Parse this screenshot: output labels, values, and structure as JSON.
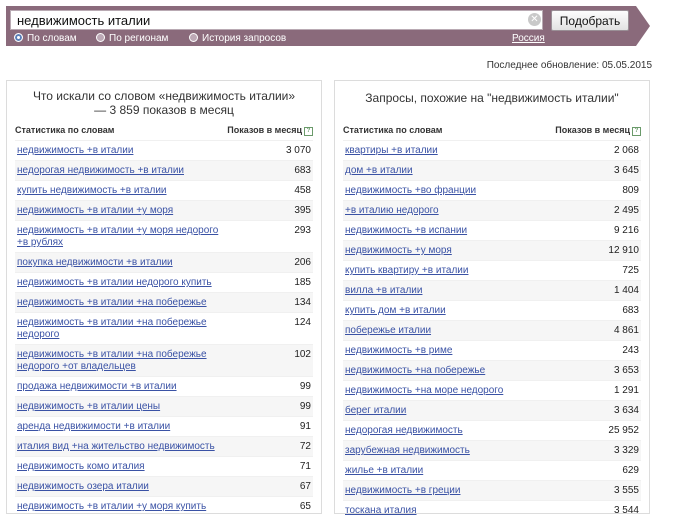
{
  "search": {
    "value": "недвижимость италии",
    "button": "Подобрать"
  },
  "tabs": [
    "По словам",
    "По регионам",
    "История запросов"
  ],
  "region": "Россия",
  "updated": "Последнее обновление: 05.05.2015",
  "left": {
    "title": "Что искали со словом «недвижимость италии» — 3 859 показов в месяц",
    "col1": "Статистика по словам",
    "col2": "Показов в месяц",
    "rows": [
      {
        "q": "недвижимость +в италии",
        "n": "3 070"
      },
      {
        "q": "недорогая недвижимость +в италии",
        "n": "683"
      },
      {
        "q": "купить недвижимость +в италии",
        "n": "458"
      },
      {
        "q": "недвижимость +в италии +у моря",
        "n": "395"
      },
      {
        "q": "недвижимость +в италии +у моря недорого +в рублях",
        "n": "293"
      },
      {
        "q": "покупка недвижимости +в италии",
        "n": "206"
      },
      {
        "q": "недвижимость +в италии недорого купить",
        "n": "185"
      },
      {
        "q": "недвижимость +в италии +на побережье",
        "n": "134"
      },
      {
        "q": "недвижимость +в италии +на побережье недорого",
        "n": "124"
      },
      {
        "q": "недвижимость +в италии +на побережье недорого +от владельцев",
        "n": "102"
      },
      {
        "q": "продажа недвижимости +в италии",
        "n": "99"
      },
      {
        "q": "недвижимость +в италии цены",
        "n": "99"
      },
      {
        "q": "аренда недвижимости +в италии",
        "n": "91"
      },
      {
        "q": "италия вид +на жительство недвижимость",
        "n": "72"
      },
      {
        "q": "недвижимость комо италия",
        "n": "71"
      },
      {
        "q": "недвижимость озера италии",
        "n": "67"
      },
      {
        "q": "недвижимость +в италии +у моря купить",
        "n": "65"
      }
    ]
  },
  "right": {
    "title": "Запросы, похожие на \"недвижимость италии\"",
    "col1": "Статистика по словам",
    "col2": "Показов в месяц",
    "rows": [
      {
        "q": "квартиры +в италии",
        "n": "2 068"
      },
      {
        "q": "дом +в италии",
        "n": "3 645"
      },
      {
        "q": "недвижимость +во франции",
        "n": "809"
      },
      {
        "q": "+в италию недорого",
        "n": "2 495"
      },
      {
        "q": "недвижимость +в испании",
        "n": "9 216"
      },
      {
        "q": "недвижимость +у моря",
        "n": "12 910"
      },
      {
        "q": "купить квартиру +в италии",
        "n": "725"
      },
      {
        "q": "вилла +в италии",
        "n": "1 404"
      },
      {
        "q": "купить дом +в италии",
        "n": "683"
      },
      {
        "q": "побережье италии",
        "n": "4 861"
      },
      {
        "q": "недвижимость +в риме",
        "n": "243"
      },
      {
        "q": "недвижимость +на побережье",
        "n": "3 653"
      },
      {
        "q": "недвижимость +на море недорого",
        "n": "1 291"
      },
      {
        "q": "берег италии",
        "n": "3 634"
      },
      {
        "q": "недорогая недвижимость",
        "n": "25 952"
      },
      {
        "q": "зарубежная недвижимость",
        "n": "3 329"
      },
      {
        "q": "жилье +в италии",
        "n": "629"
      },
      {
        "q": "недвижимость +в греции",
        "n": "3 555"
      },
      {
        "q": "тоскана италия",
        "n": "3 544"
      }
    ]
  }
}
